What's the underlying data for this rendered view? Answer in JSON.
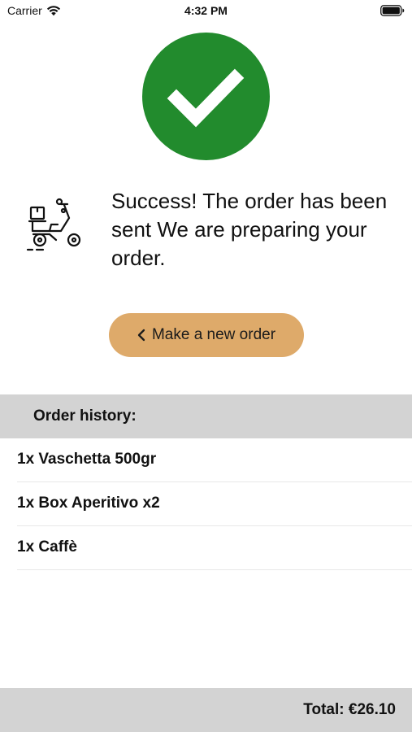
{
  "status_bar": {
    "carrier": "Carrier",
    "time": "4:32 PM"
  },
  "icons": {
    "status": "check-icon",
    "delivery": "scooter-icon",
    "back": "chevron-left-icon"
  },
  "colors": {
    "success": "#228b2d",
    "button": "#deaa6a",
    "section_bg": "#d3d3d3"
  },
  "message": {
    "text": "Success! The order has been sent We are preparing your order."
  },
  "actions": {
    "new_order_label": "Make a new order"
  },
  "history": {
    "title": "Order history:",
    "items": [
      "1x Vaschetta 500gr",
      "1x Box Aperitivo x2",
      "1x Caffè"
    ]
  },
  "footer": {
    "total": "Total: €26.10"
  }
}
